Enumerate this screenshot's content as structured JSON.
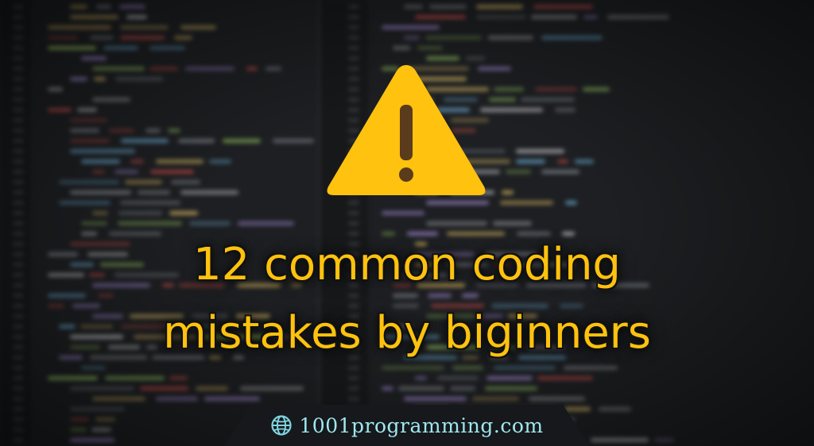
{
  "headline": {
    "line1": "12 common coding",
    "line2": "mistakes by biginners"
  },
  "footer": {
    "site": "1001programming.com",
    "icon": "globe-icon"
  },
  "icons": {
    "warning": "warning-triangle-icon"
  },
  "colors": {
    "accent": "#ffc20e",
    "site_text": "#9fe7ef",
    "exclamation": "#5a3b1c"
  }
}
